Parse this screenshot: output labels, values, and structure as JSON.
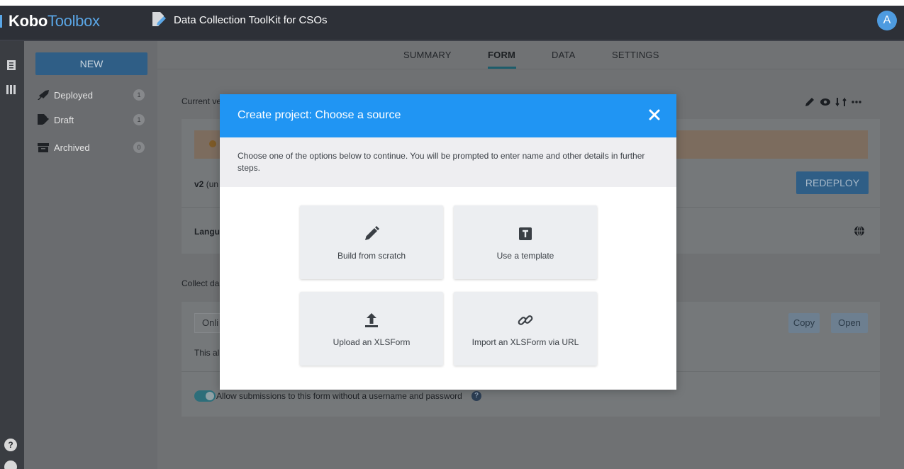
{
  "app": {
    "logo_kobo": "Kobo",
    "logo_toolbox": "Toolbox",
    "project_title": "Data Collection ToolKit for CSOs",
    "avatar_letter": "A"
  },
  "sidebar": {
    "new_button": "NEW",
    "items": [
      {
        "label": "Deployed",
        "count": "1",
        "icon": "rocket-icon"
      },
      {
        "label": "Draft",
        "count": "1",
        "icon": "draft-icon"
      },
      {
        "label": "Archived",
        "count": "0",
        "icon": "archive-icon"
      }
    ]
  },
  "tabs": [
    {
      "label": "SUMMARY",
      "active": false
    },
    {
      "label": "FORM",
      "active": true
    },
    {
      "label": "DATA",
      "active": false
    },
    {
      "label": "SETTINGS",
      "active": false
    }
  ],
  "background": {
    "current_version_label": "Current ve",
    "version_label": "v2",
    "version_suffix": " (un",
    "redeploy_button": "REDEPLOY",
    "languages_label": "Langu",
    "collect_data_label": "Collect da",
    "online_select": "Onli",
    "this_allows_text": "This al",
    "copy_button": "Copy",
    "open_button": "Open",
    "allow_submissions_text": "Allow submissions to this form without a username and password",
    "help_glyph": "?"
  },
  "modal": {
    "title": "Create project: Choose a source",
    "description": "Choose one of the options below to continue. You will be prompted to enter name and other details in further steps.",
    "options": [
      {
        "label": "Build from scratch",
        "icon": "pencil-icon"
      },
      {
        "label": "Use a template",
        "icon": "template-icon"
      },
      {
        "label": "Upload an XLSForm",
        "icon": "upload-icon"
      },
      {
        "label": "Import an XLSForm via URL",
        "icon": "link-icon"
      }
    ]
  },
  "colors": {
    "modal_header": "#2095f3",
    "primary_button": "#2f5e86",
    "header_bg": "#2d3037"
  }
}
